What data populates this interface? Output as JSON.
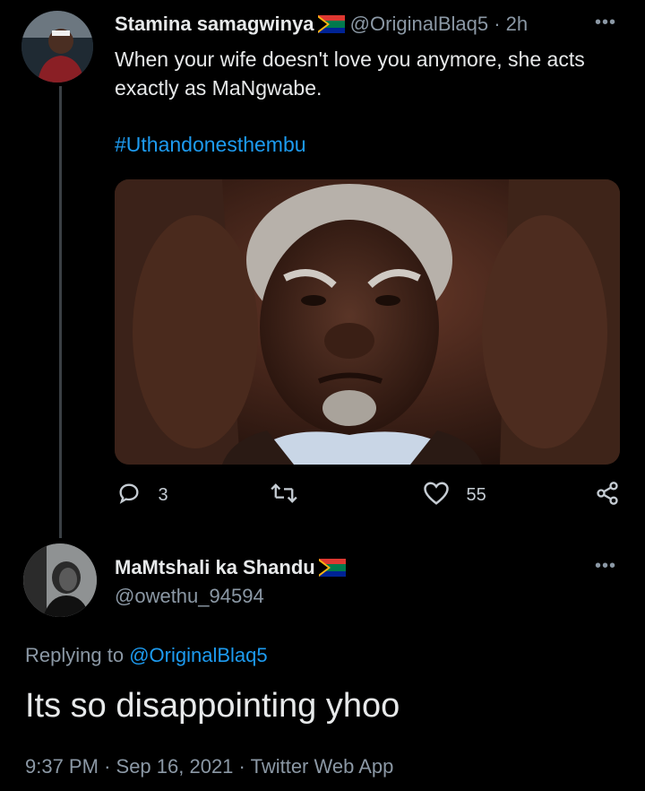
{
  "tweet1": {
    "author_name": "Stamina samagwinya",
    "handle": "@OriginalBlaq5",
    "time": "2h",
    "text": "When your wife doesn't love you anymore, she acts exactly as MaNgwabe.",
    "hashtag": "#Uthandonesthembu",
    "reply_count": "3",
    "like_count": "55"
  },
  "tweet2": {
    "author_name": "MaMtshali ka Shandu",
    "handle": "@owethu_94594",
    "replying_label": "Replying to",
    "replying_handle": "@OriginalBlaq5",
    "text": "Its so disappointing yhoo",
    "time": "9:37 PM",
    "date": "Sep 16, 2021",
    "source": "Twitter Web App"
  },
  "separator": "·",
  "icons": {
    "more": "more-icon",
    "reply": "reply-icon",
    "retweet": "retweet-icon",
    "like": "like-icon",
    "share": "share-icon",
    "flag": "south-africa-flag-icon"
  }
}
